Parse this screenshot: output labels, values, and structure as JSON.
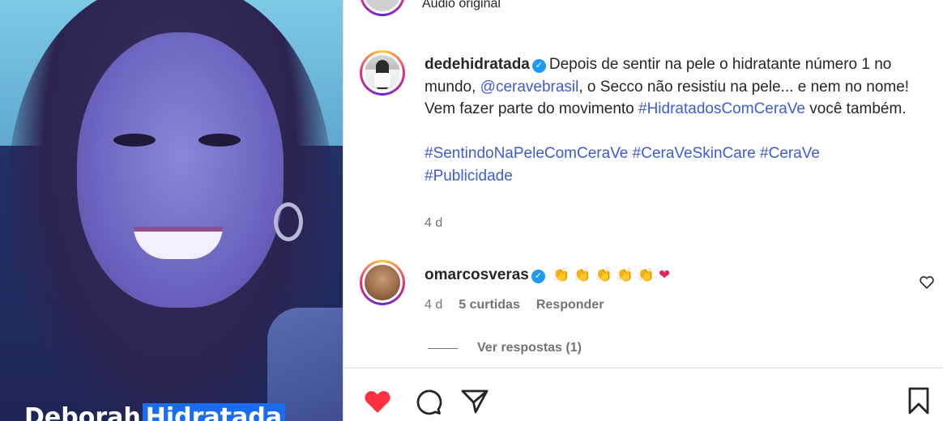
{
  "media": {
    "overlay_text_1": "Deborah",
    "overlay_text_2": "Hidratada"
  },
  "header": {
    "audio_label": "Áudio original"
  },
  "post": {
    "username": "dedehidratada",
    "verified_icon": "verified-badge-icon",
    "caption_part1": "Depois de sentir na pele o hidratante número 1 no mundo, ",
    "mention": "@ceravebrasil",
    "caption_part2": ", o Secco não resistiu na pele... e nem no nome! Vem fazer parte do movimento ",
    "hashtag1": "#HidratadosComCeraVe",
    "caption_part3": " você também.",
    "hashtag2": "#SentindoNaPeleComCeraVe",
    "hashtag3": "#CeraVeSkinCare",
    "hashtag4": "#CeraVe",
    "hashtag5": "#Publicidade",
    "time": "4 d"
  },
  "comment": {
    "username": "omarcosveras",
    "emojis": "👏👏👏👏👏",
    "heart": "❤",
    "time": "4 d",
    "likes": "5 curtidas",
    "reply_label": "Responder",
    "view_replies": "Ver respostas (1)"
  },
  "actions": {
    "like": "heart-filled-icon",
    "comment": "comment-icon",
    "share": "share-icon",
    "save": "bookmark-icon"
  },
  "colors": {
    "link": "#3d5cd6",
    "like_red": "#ff3040",
    "muted": "#737373",
    "verified": "#1d9bf0"
  }
}
